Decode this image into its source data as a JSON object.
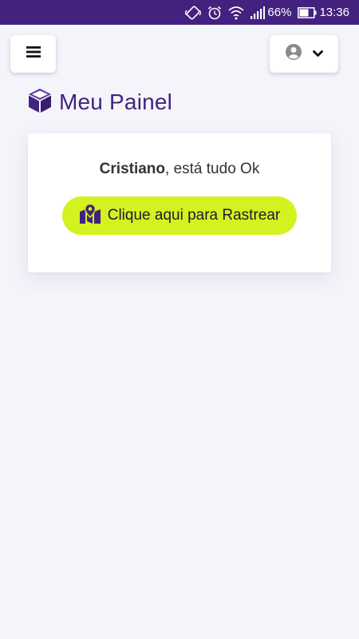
{
  "status_bar": {
    "battery": "66%",
    "time": "13:36"
  },
  "page": {
    "title": "Meu Painel"
  },
  "card": {
    "user_name": "Cristiano",
    "status_text": ", está tudo Ok",
    "track_button_label": "Clique aqui para Rastrear"
  },
  "colors": {
    "brand_purple": "#43227f",
    "accent_lime": "#d3f21f",
    "background": "#f4f5fa"
  },
  "icons": {
    "menu": "hamburger-icon",
    "user": "user-circle-icon",
    "dropdown": "chevron-down-icon",
    "logo": "cube-icon",
    "track": "map-icon"
  }
}
